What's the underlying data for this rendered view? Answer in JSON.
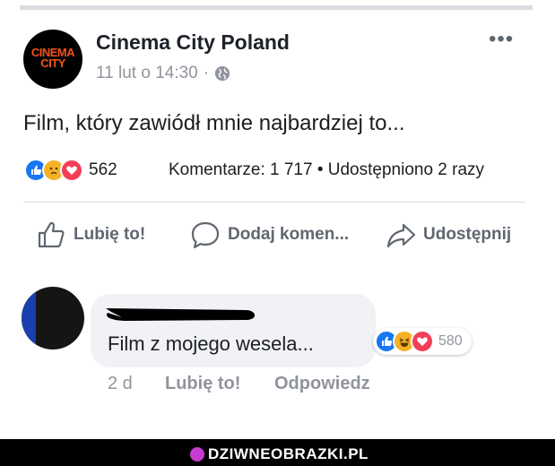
{
  "post": {
    "author": "Cinema City Poland",
    "avatar_logo_lines": [
      "CINEMA",
      "CITY"
    ],
    "timestamp": "11 lut o 14:30",
    "separator": "·",
    "privacy_icon": "globe-icon",
    "more_label": "•••",
    "text": "Film, który zawiódł mnie najbardziej to...",
    "reactions": {
      "icons": [
        "like-icon",
        "sad-icon",
        "love-icon"
      ],
      "count": "562"
    },
    "comments_label": "Komentarze: 1 717",
    "stats_separator": "•",
    "shares_label": "Udostępniono 2 razy"
  },
  "actions": {
    "like_label": "Lubię to!",
    "comment_label": "Dodaj komen...",
    "share_label": "Udostępnij"
  },
  "comment": {
    "text": "Film z mojego wesela...",
    "reactions": {
      "icons": [
        "like-icon",
        "haha-icon",
        "love-icon"
      ],
      "count": "580"
    },
    "time": "2 d",
    "like_label": "Lubię to!",
    "reply_label": "Odpowiedz"
  },
  "watermark": {
    "text": "DZIWNEOBRAZKI.PL"
  },
  "colors": {
    "like_blue": "#1877f2",
    "love_red": "#f33e58",
    "emoji_yellow": "#f7b125",
    "logo_orange": "#f2541b",
    "muted_gray": "#90949c"
  }
}
